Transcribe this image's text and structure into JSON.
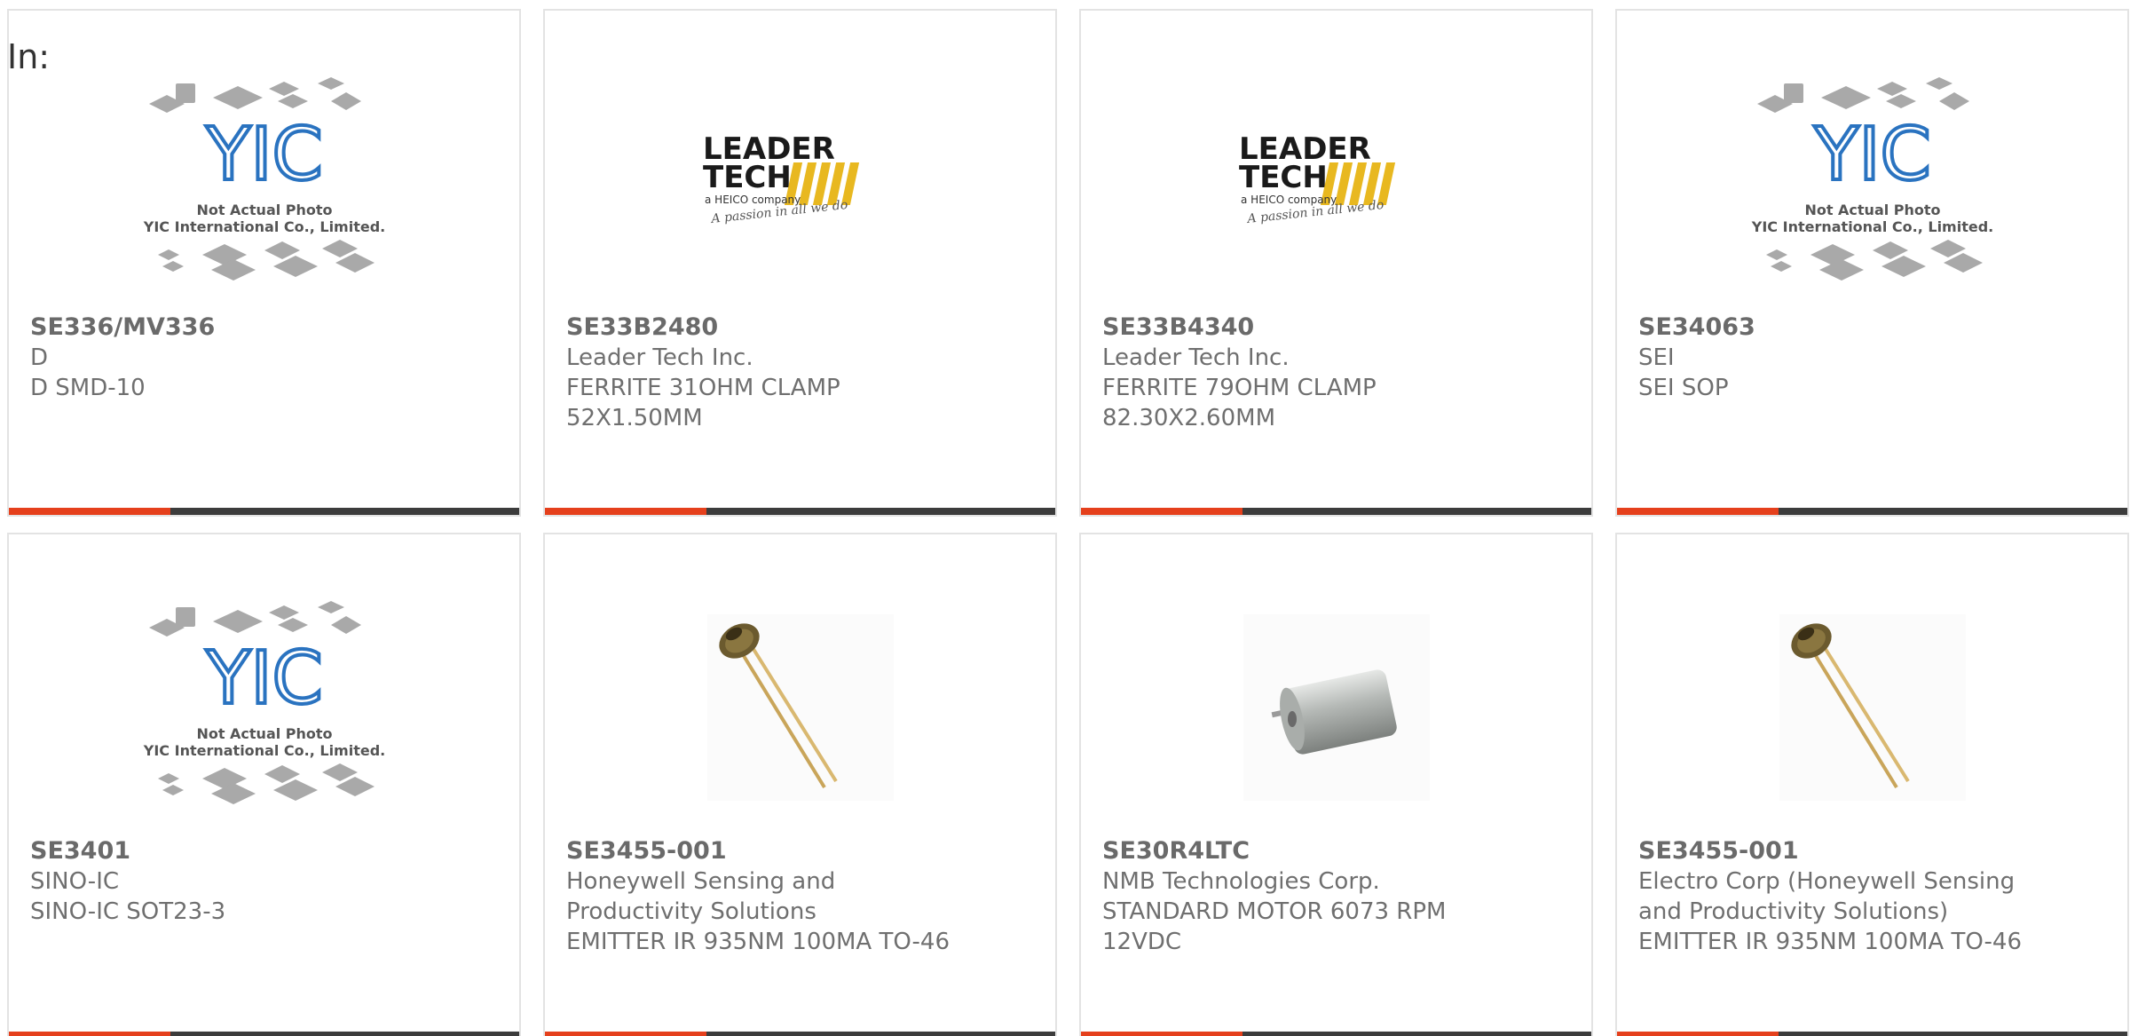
{
  "header": {
    "in_label": "In:"
  },
  "colors": {
    "accent": "#e5401c",
    "bar": "#3c3c3c",
    "yic_blue": "#2a73c0",
    "leader_yellow": "#e8b820"
  },
  "placeholder": {
    "line1": "Not Actual Photo",
    "line2": "YIC International Co., Limited.",
    "logo_text": "YIC"
  },
  "leader_logo": {
    "word1": "LEADER",
    "word2": "TECH",
    "tagline": "a HEICO company",
    "script": "A passion in all we do"
  },
  "products": [
    {
      "part_number": "SE336/MV336",
      "manufacturer": "D",
      "desc1": "D SMD-10",
      "desc2": "",
      "image": "yic-placeholder"
    },
    {
      "part_number": "SE33B2480",
      "manufacturer": "Leader Tech Inc.",
      "desc1": "FERRITE 31OHM CLAMP",
      "desc2": "52X1.50MM",
      "image": "leader-tech-logo"
    },
    {
      "part_number": "SE33B4340",
      "manufacturer": "Leader Tech Inc.",
      "desc1": "FERRITE 79OHM CLAMP",
      "desc2": "82.30X2.60MM",
      "image": "leader-tech-logo"
    },
    {
      "part_number": "SE34063",
      "manufacturer": "SEI",
      "desc1": "SEI SOP",
      "desc2": "",
      "image": "yic-placeholder"
    },
    {
      "part_number": "SE3401",
      "manufacturer": "SINO-IC",
      "desc1": "SINO-IC SOT23-3",
      "desc2": "",
      "image": "yic-placeholder"
    },
    {
      "part_number": "SE3455-001",
      "manufacturer": "Honeywell Sensing and",
      "desc1": "Productivity Solutions",
      "desc2": "EMITTER IR 935NM 100MA TO-46",
      "image": "ir-emitter-photo"
    },
    {
      "part_number": "SE30R4LTC",
      "manufacturer": "NMB Technologies Corp.",
      "desc1": "STANDARD MOTOR 6073 RPM",
      "desc2": "12VDC",
      "image": "motor-photo"
    },
    {
      "part_number": "SE3455-001",
      "manufacturer": "Electro Corp (Honeywell Sensing",
      "desc1": "and Productivity Solutions)",
      "desc2": "EMITTER IR 935NM 100MA TO-46",
      "image": "ir-emitter-photo"
    }
  ]
}
